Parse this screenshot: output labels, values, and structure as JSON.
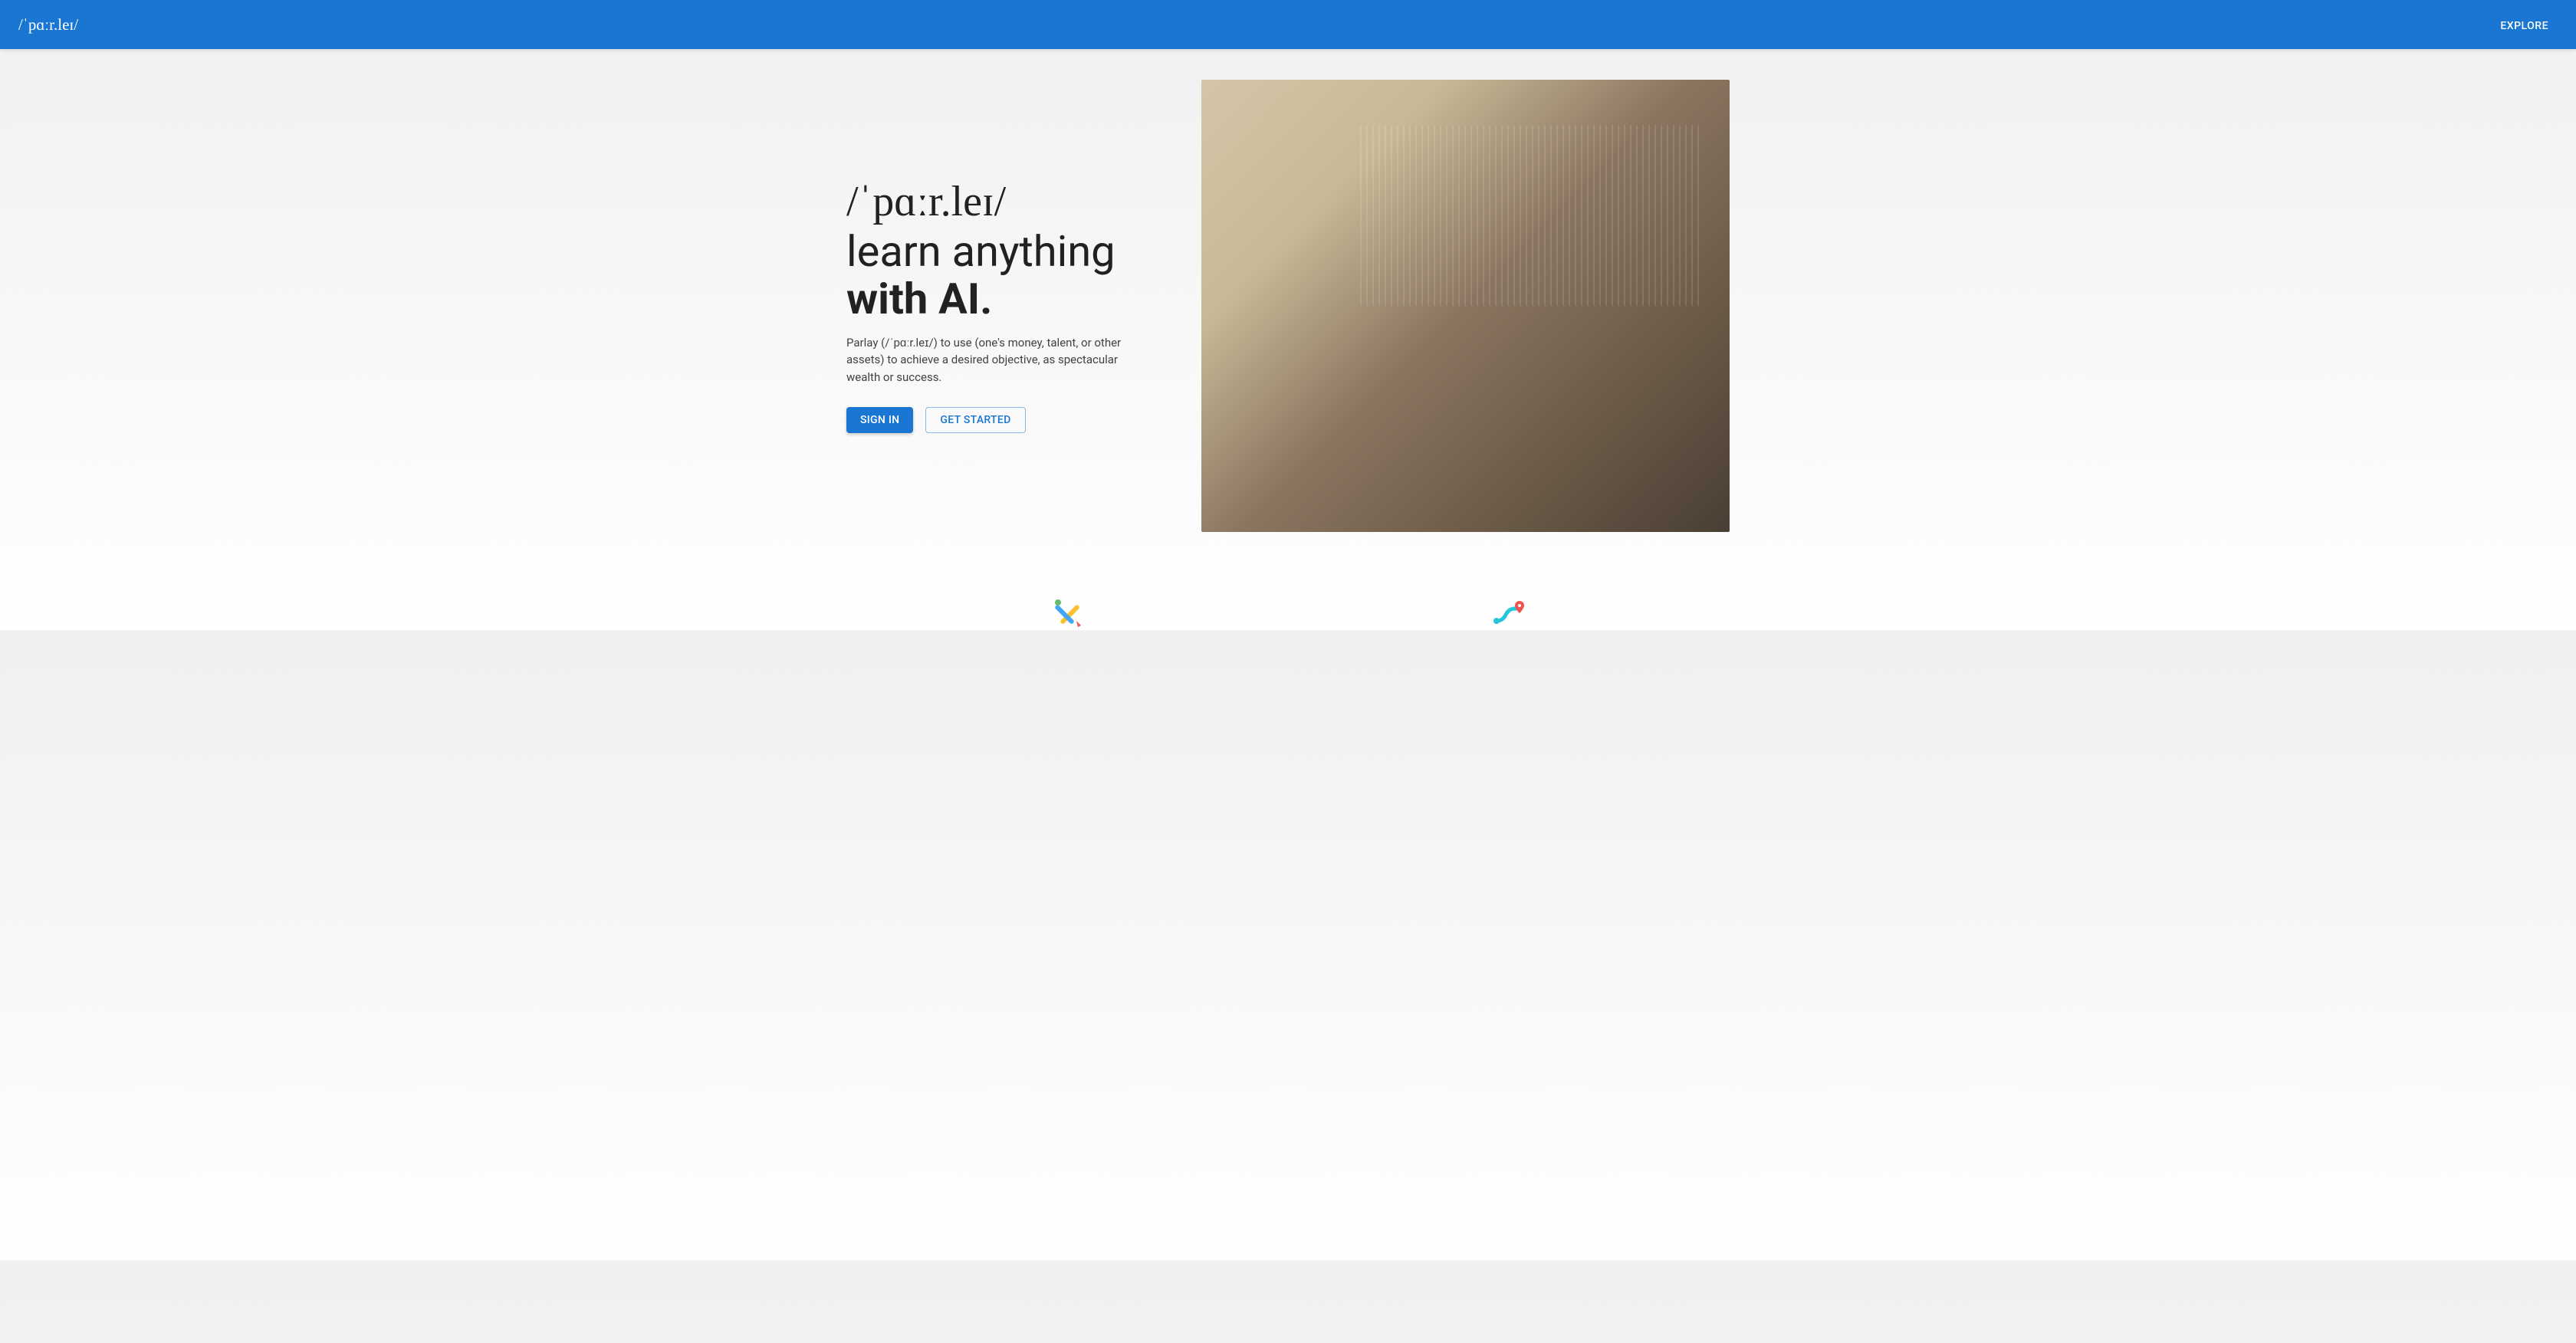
{
  "header": {
    "logo": "/ˈpɑːr.leɪ/",
    "nav": {
      "explore": "EXPLORE"
    }
  },
  "hero": {
    "title_line1": "/ˈpɑːr.leɪ/",
    "title_line2_plain": "learn anything ",
    "title_line2_bold": "with AI.",
    "description": "Parlay (/ˈpɑːr.leɪ/) to use (one's money, talent, or other assets) to achieve a desired objective, as spectacular wealth or success.",
    "buttons": {
      "signin": "SIGN IN",
      "getstarted": "GET STARTED"
    }
  }
}
